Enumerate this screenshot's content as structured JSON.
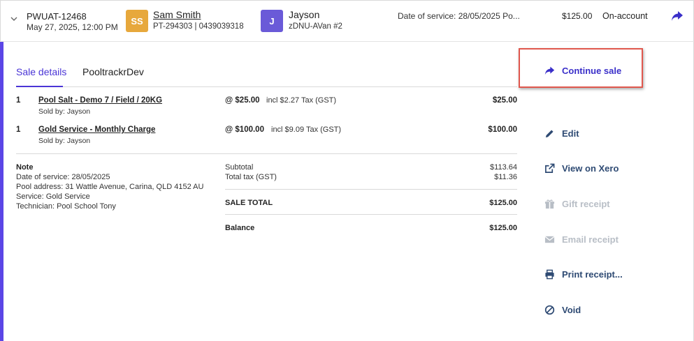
{
  "sale": {
    "id": "PWUAT-12468",
    "datetime": "May 27, 2025, 12:00 PM",
    "customer": {
      "initials": "SS",
      "name": "Sam Smith",
      "sub": "PT-294303 | 0439039318"
    },
    "technician": {
      "initials": "J",
      "name": "Jayson",
      "sub": "zDNU-AVan #2"
    },
    "date_of_service": "Date of service: 28/05/2025 Po...",
    "amount": "$125.00",
    "payment_status": "On-account"
  },
  "tabs": [
    {
      "label": "Sale details"
    },
    {
      "label": "PooltrackrDev"
    }
  ],
  "line_items": [
    {
      "qty": "1",
      "name": "Pool Salt - Demo 7 / Field / 20KG",
      "sold_by": "Sold by: Jayson",
      "unit_price": "@ $25.00",
      "tax": "incl $2.27 Tax (GST)",
      "total": "$25.00"
    },
    {
      "qty": "1",
      "name": "Gold Service - Monthly Charge",
      "sold_by": "Sold by: Jayson",
      "unit_price": "@ $100.00",
      "tax": "incl $9.09 Tax (GST)",
      "total": "$100.00"
    }
  ],
  "note": {
    "title": "Note",
    "lines": [
      "Date of service: 28/05/2025",
      "Pool address: 31 Wattle Avenue, Carina, QLD 4152 AU",
      "Service: Gold Service",
      "Technician: Pool School Tony"
    ]
  },
  "totals": {
    "subtotal_label": "Subtotal",
    "subtotal": "$113.64",
    "tax_label": "Total tax (GST)",
    "tax": "$11.36",
    "sale_total_label": "SALE TOTAL",
    "sale_total": "$125.00",
    "balance_label": "Balance",
    "balance": "$125.00"
  },
  "actions": {
    "continue_sale": "Continue sale",
    "edit": "Edit",
    "view_on_xero": "View on Xero",
    "gift_receipt": "Gift receipt",
    "email_receipt": "Email receipt",
    "print_receipt": "Print receipt...",
    "void": "Void"
  },
  "colors": {
    "accent": "#5b46e6",
    "primary_action": "#3a2fc9",
    "action_text": "#2e4a73",
    "disabled": "#b8bec6",
    "highlight_border": "#e0574d",
    "customer_avatar": "#e7a83c",
    "technician_avatar": "#6a5ad8"
  },
  "icons": {
    "expand": "chevron-down-icon",
    "share": "share-arrow-icon",
    "continue": "share-arrow-icon",
    "edit": "pencil-icon",
    "xero": "external-link-icon",
    "gift": "gift-icon",
    "email": "envelope-icon",
    "print": "printer-icon",
    "void": "ban-icon"
  }
}
